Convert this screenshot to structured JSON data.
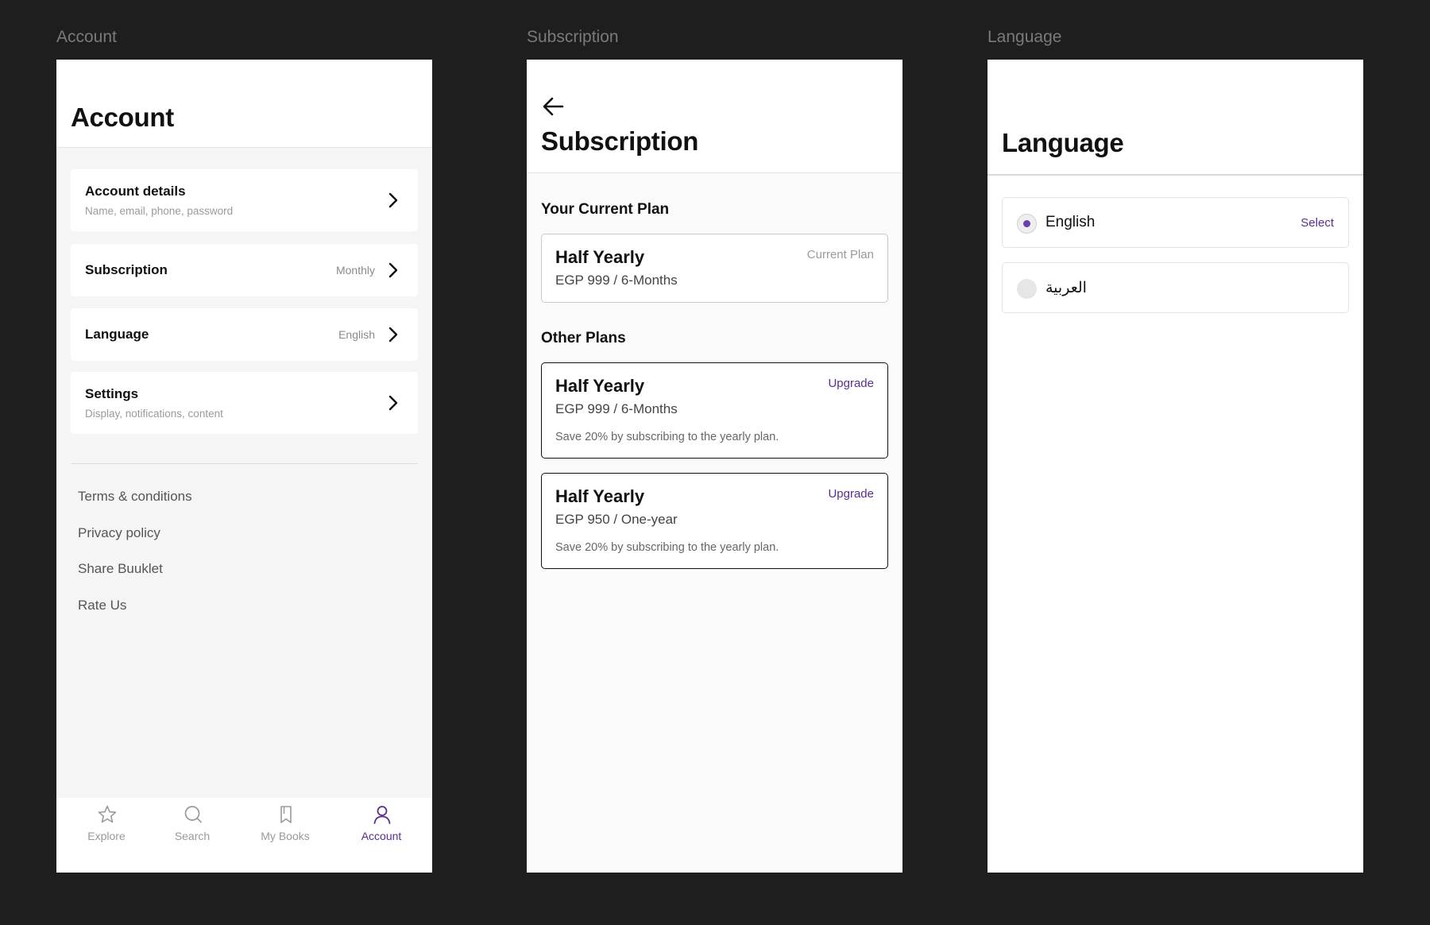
{
  "frames": {
    "account": "Account",
    "subscription": "Subscription",
    "language": "Language"
  },
  "account": {
    "title": "Account",
    "items": [
      {
        "title": "Account details",
        "subtitle": "Name, email, phone, password",
        "value": ""
      },
      {
        "title": "Subscription",
        "subtitle": "",
        "value": "Monthly"
      },
      {
        "title": "Language",
        "subtitle": "",
        "value": "English"
      },
      {
        "title": "Settings",
        "subtitle": "Display, notifications, content",
        "value": ""
      }
    ],
    "links": [
      "Terms & conditions",
      "Privacy policy",
      "Share Buuklet",
      "Rate Us"
    ],
    "tabs": [
      {
        "label": "Explore",
        "icon": "star-icon"
      },
      {
        "label": "Search",
        "icon": "search-icon"
      },
      {
        "label": "My Books",
        "icon": "bookmark-icon"
      },
      {
        "label": "Account",
        "icon": "user-icon"
      }
    ],
    "active_tab": "Account"
  },
  "subscription": {
    "title": "Subscription",
    "current_heading": "Your Current Plan",
    "current_plan": {
      "name": "Half Yearly",
      "price": "EGP 999 / 6-Months",
      "badge": "Current Plan"
    },
    "other_heading": "Other Plans",
    "other_plans": [
      {
        "name": "Half Yearly",
        "price": "EGP 999 / 6-Months",
        "note": "Save 20% by subscribing to the yearly plan.",
        "action": "Upgrade"
      },
      {
        "name": "Half Yearly",
        "price": "EGP 950 / One-year",
        "note": "Save 20% by subscribing to the yearly plan.",
        "action": "Upgrade"
      }
    ]
  },
  "language": {
    "title": "Language",
    "options": [
      {
        "name": "English",
        "selected": true,
        "action": "Select"
      },
      {
        "name": "العربية",
        "selected": false,
        "action": ""
      }
    ]
  },
  "colors": {
    "accent": "#5b2d91",
    "canvas": "#1e1e1e"
  }
}
